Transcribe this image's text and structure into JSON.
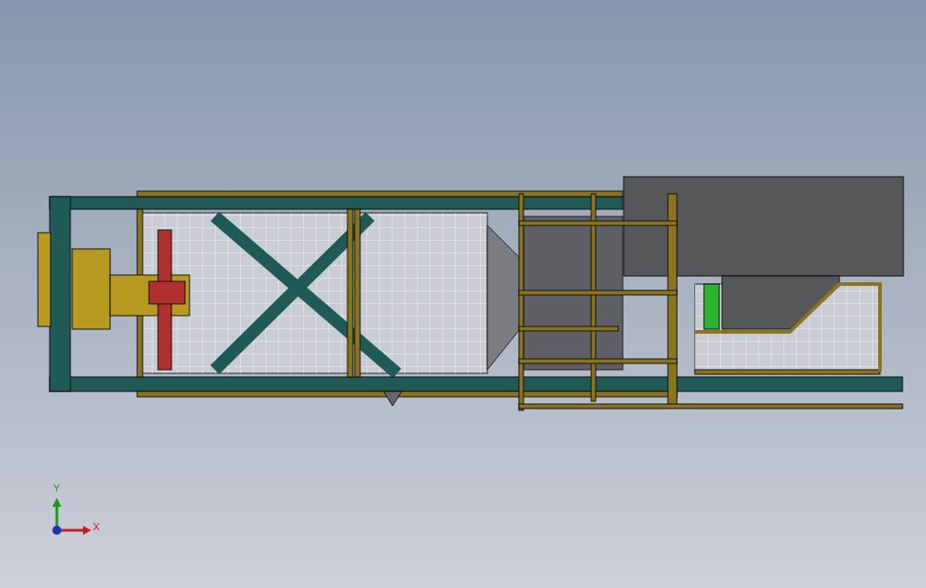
{
  "axis_triad": {
    "y_label": "Y",
    "x_label": "X"
  }
}
